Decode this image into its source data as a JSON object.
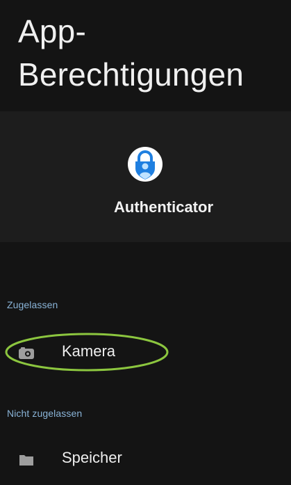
{
  "header": {
    "title_line1": "App-",
    "title_line2": "Berechtigungen"
  },
  "app": {
    "name": "Authenticator",
    "icon": "authenticator-lock-icon"
  },
  "sections": {
    "allowed": {
      "label": "Zugelassen",
      "items": [
        {
          "label": "Kamera",
          "icon": "camera-icon"
        }
      ]
    },
    "denied": {
      "label": "Nicht zugelassen",
      "items": [
        {
          "label": "Speicher",
          "icon": "folder-icon"
        }
      ]
    }
  },
  "colors": {
    "background": "#141414",
    "app_header_bg": "#1d1d1d",
    "section_label": "#8ab4d8",
    "highlight": "#8cc63f",
    "app_icon_blue": "#1f7fe0"
  }
}
